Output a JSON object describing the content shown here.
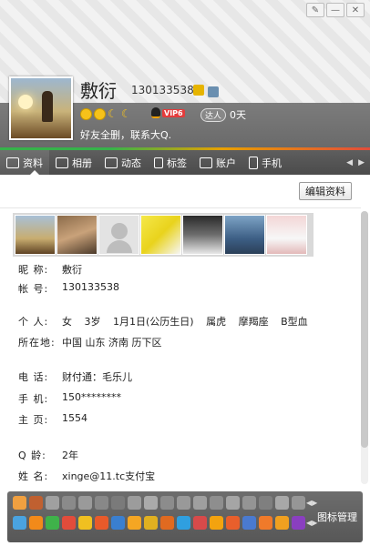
{
  "window": {
    "controls": [
      "feedback",
      "minimize",
      "close"
    ]
  },
  "profile": {
    "nickname": "敷衍",
    "qq_number": "130133538",
    "vip_label": "VIP6",
    "days_badge": "达人",
    "days_value": "0天",
    "signature": "好友全删，联系大Q."
  },
  "tabs": [
    {
      "label": "资料",
      "icon": "profile-card-icon"
    },
    {
      "label": "相册",
      "icon": "photo-album-icon"
    },
    {
      "label": "动态",
      "icon": "feed-icon"
    },
    {
      "label": "标签",
      "icon": "bookmark-tag-icon"
    },
    {
      "label": "账户",
      "icon": "wallet-icon"
    },
    {
      "label": "手机",
      "icon": "phone-icon"
    }
  ],
  "actions": {
    "edit_profile": "编辑资料"
  },
  "info": {
    "nickname_label": "昵    称:",
    "nickname_value": "敷衍",
    "account_label": "帐    号:",
    "account_value": "130133538",
    "personal_label": "个    人:",
    "gender": "女",
    "age": "3岁",
    "birthday": "1月1日(公历生日)",
    "zodiac": "属虎",
    "constellation": "摩羯座",
    "blood_type": "B型血",
    "location_label": "所在地:",
    "location_value": "中国 山东 济南 历下区",
    "phone_label": "电    话:",
    "phone_value": "财付通：毛乐儿",
    "mobile_label": "手    机:",
    "mobile_value": "150********",
    "homepage_label": "主    页:",
    "homepage_value": "1554",
    "qage_label": "Q    龄:",
    "qage_value": "2年",
    "name_label": "姓    名:",
    "name_value": "xinge@11.tc支付宝"
  },
  "footer": {
    "manage_label": "图标管理"
  },
  "colors": {
    "accent_green": "#37b34a",
    "tab_bar": "#555555",
    "header_dark": "#707070"
  }
}
